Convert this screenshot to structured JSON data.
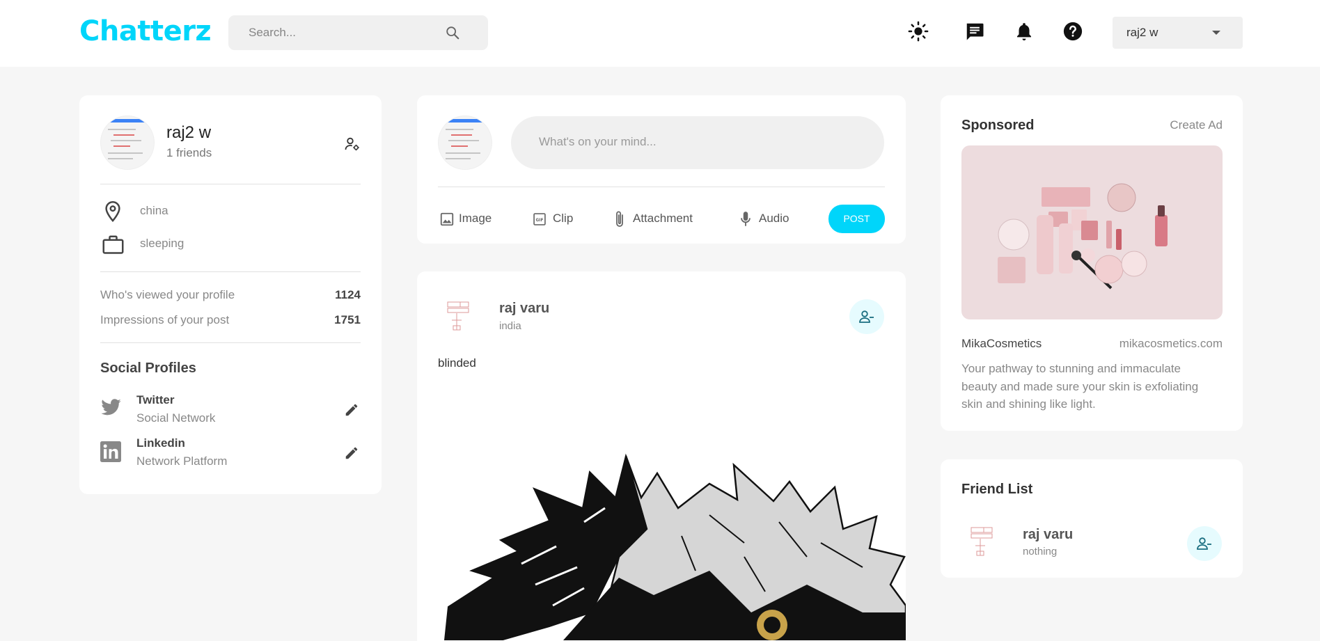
{
  "app": {
    "name": "Chatterz"
  },
  "navbar": {
    "search_placeholder": "Search...",
    "user": "raj2 w",
    "icons": [
      "sun-icon",
      "message-icon",
      "bell-icon",
      "help-icon"
    ]
  },
  "profile": {
    "name": "raj2 w",
    "friends": "1 friends",
    "location": "china",
    "occupation": "sleeping",
    "stats": [
      {
        "label": "Who's viewed your profile",
        "value": "1124"
      },
      {
        "label": "Impressions of your post",
        "value": "1751"
      }
    ],
    "social_title": "Social Profiles",
    "socials": [
      {
        "name": "Twitter",
        "type": "Social Network"
      },
      {
        "name": "Linkedin",
        "type": "Network Platform"
      }
    ]
  },
  "composer": {
    "placeholder": "What's on your mind...",
    "actions": [
      "Image",
      "Clip",
      "Attachment",
      "Audio"
    ],
    "post_label": "POST"
  },
  "post": {
    "author": "raj varu",
    "location": "india",
    "text": "blinded"
  },
  "sponsored": {
    "title": "Sponsored",
    "create_ad": "Create Ad",
    "brand": "MikaCosmetics",
    "url": "mikacosmetics.com",
    "description_lines": [
      "Your pathway to stunning and immaculate",
      "beauty and made sure your skin is exfoliating",
      "skin and shining like light."
    ]
  },
  "friend_list": {
    "title": "Friend List",
    "friends": [
      {
        "name": "raj varu",
        "subtitle": "nothing"
      }
    ]
  },
  "colors": {
    "accent": "#00d5fa",
    "background": "#f6f6f6",
    "card": "#ffffff"
  }
}
